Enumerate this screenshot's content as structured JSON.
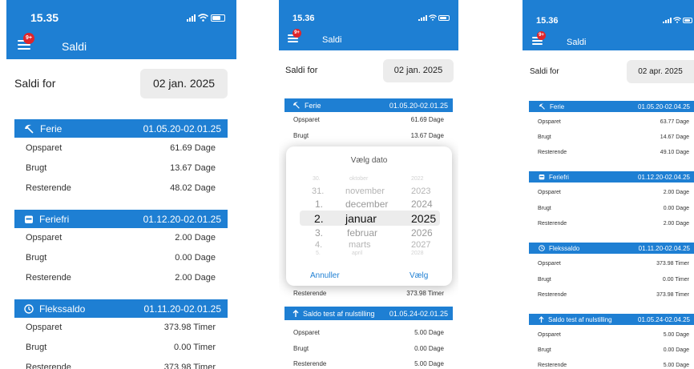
{
  "phone1": {
    "time": "15.35",
    "badge": "9+",
    "title": "Saldi",
    "saldi_for": "Saldi for",
    "date": "02 jan. 2025",
    "sections": [
      {
        "name": "Ferie",
        "range": "01.05.20-02.01.25",
        "icon": "beach-umbrella-icon",
        "rows": [
          {
            "label": "Opsparet",
            "value": "61.69 Dage"
          },
          {
            "label": "Brugt",
            "value": "13.67 Dage"
          },
          {
            "label": "Resterende",
            "value": "48.02 Dage"
          }
        ]
      },
      {
        "name": "Feriefri",
        "range": "01.12.20-02.01.25",
        "icon": "calendar-icon",
        "rows": [
          {
            "label": "Opsparet",
            "value": "2.00 Dage"
          },
          {
            "label": "Brugt",
            "value": "0.00 Dage"
          },
          {
            "label": "Resterende",
            "value": "2.00 Dage"
          }
        ]
      },
      {
        "name": "Flekssaldo",
        "range": "01.11.20-02.01.25",
        "icon": "clock-icon",
        "rows": [
          {
            "label": "Opsparet",
            "value": "373.98 Timer"
          },
          {
            "label": "Brugt",
            "value": "0.00 Timer"
          },
          {
            "label": "Resterende",
            "value": "373.98 Timer"
          }
        ]
      }
    ]
  },
  "phone2": {
    "time": "15.36",
    "badge": "9+",
    "title": "Saldi",
    "saldi_for": "Saldi for",
    "date": "02 jan. 2025",
    "ferie": {
      "name": "Ferie",
      "range": "01.05.20-02.01.25",
      "rows": [
        {
          "label": "Opsparet",
          "value": "61.69 Dage"
        },
        {
          "label": "Brugt",
          "value": "13.67 Dage"
        }
      ]
    },
    "hidden_row": {
      "label": "Resterende",
      "value": "373.98 Timer"
    },
    "saldo_test": {
      "name": "Saldo test af nulstilling",
      "range": "01.05.24-02.01.25",
      "icon": "arrow-up-icon",
      "rows": [
        {
          "label": "Opsparet",
          "value": "5.00 Dage"
        },
        {
          "label": "Brugt",
          "value": "0.00 Dage"
        },
        {
          "label": "Resterende",
          "value": "5.00 Dage"
        }
      ]
    },
    "picker": {
      "title": "Vælg dato",
      "days": [
        "30.",
        "31.",
        "1.",
        "2.",
        "3.",
        "4.",
        "5."
      ],
      "months": [
        "oktober",
        "november",
        "december",
        "januar",
        "februar",
        "marts",
        "april"
      ],
      "years": [
        "2022",
        "2023",
        "2024",
        "2025",
        "2026",
        "2027",
        "2028"
      ],
      "selected_index": 3,
      "cancel": "Annuller",
      "confirm": "Vælg"
    }
  },
  "phone3": {
    "time": "15.36",
    "badge": "9+",
    "title": "Saldi",
    "saldi_for": "Saldi for",
    "date": "02 apr. 2025",
    "sections": [
      {
        "name": "Ferie",
        "range": "01.05.20-02.04.25",
        "icon": "beach-umbrella-icon",
        "rows": [
          {
            "label": "Opsparet",
            "value": "63.77 Dage"
          },
          {
            "label": "Brugt",
            "value": "14.67 Dage"
          },
          {
            "label": "Resterende",
            "value": "49.10 Dage"
          }
        ]
      },
      {
        "name": "Feriefri",
        "range": "01.12.20-02.04.25",
        "icon": "calendar-icon",
        "rows": [
          {
            "label": "Opsparet",
            "value": "2.00 Dage"
          },
          {
            "label": "Brugt",
            "value": "0.00 Dage"
          },
          {
            "label": "Resterende",
            "value": "2.00 Dage"
          }
        ]
      },
      {
        "name": "Flekssaldo",
        "range": "01.11.20-02.04.25",
        "icon": "clock-icon",
        "rows": [
          {
            "label": "Opsparet",
            "value": "373.98 Timer"
          },
          {
            "label": "Brugt",
            "value": "0.00 Timer"
          },
          {
            "label": "Resterende",
            "value": "373.98 Timer"
          }
        ]
      },
      {
        "name": "Saldo test af nulstilling",
        "range": "01.05.24-02.04.25",
        "icon": "arrow-up-icon",
        "rows": [
          {
            "label": "Opsparet",
            "value": "5.00 Dage"
          },
          {
            "label": "Brugt",
            "value": "0.00 Dage"
          },
          {
            "label": "Resterende",
            "value": "5.00 Dage"
          }
        ]
      }
    ]
  },
  "colors": {
    "brand": "#1e7fd3",
    "badge": "#e0252b"
  }
}
